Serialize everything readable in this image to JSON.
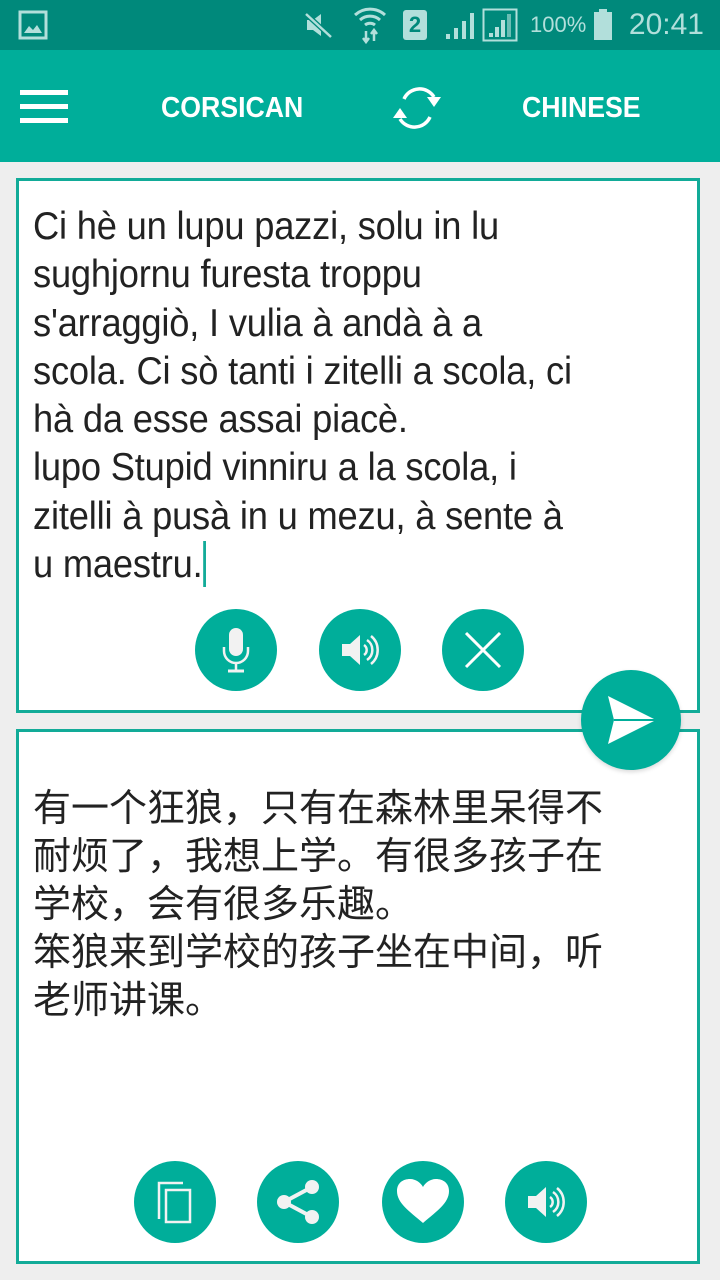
{
  "status_bar": {
    "time": "20:41",
    "battery_percent": "100%",
    "sim_slot": "2",
    "icons": [
      "gallery-notification-icon",
      "mute-icon",
      "wifi-data-icon",
      "sim-2-icon",
      "signal-icon",
      "signal-roaming-icon",
      "battery-icon"
    ]
  },
  "toolbar": {
    "menu_icon": "hamburger-menu-icon",
    "source_language": "CORSICAN",
    "swap_icon": "swap-languages-icon",
    "target_language": "CHINESE"
  },
  "source_panel": {
    "text": "Ci hè un lupu pazzi, solu in lu\nsughjornu furesta troppu\ns'arraggiò, I vulia à andà à a\nscola. Ci sò tanti i zitelli a scola, ci\nhà da esse assai piacè.\nlupo Stupid vinniru a la scola, i\nzitelli à pusà in u mezu, à sente à\nu maestru.",
    "buttons": [
      {
        "name": "microphone",
        "icon": "microphone-icon"
      },
      {
        "name": "speak",
        "icon": "speaker-icon"
      },
      {
        "name": "clear",
        "icon": "close-icon"
      }
    ]
  },
  "translate_button": {
    "icon": "send-icon"
  },
  "target_panel": {
    "text": "有一个狂狼，只有在森林里呆得不\n耐烦了，我想上学。有很多孩子在\n学校，会有很多乐趣。\n笨狼来到学校的孩子坐在中间，听\n老师讲课。",
    "buttons": [
      {
        "name": "copy",
        "icon": "copy-icon"
      },
      {
        "name": "share",
        "icon": "share-icon"
      },
      {
        "name": "favorite",
        "icon": "heart-icon"
      },
      {
        "name": "speak",
        "icon": "speaker-icon"
      }
    ]
  },
  "colors": {
    "status_bar": "#00897b",
    "accent": "#00ae9a",
    "card_border": "#12ab98",
    "background": "#eeeeee"
  }
}
